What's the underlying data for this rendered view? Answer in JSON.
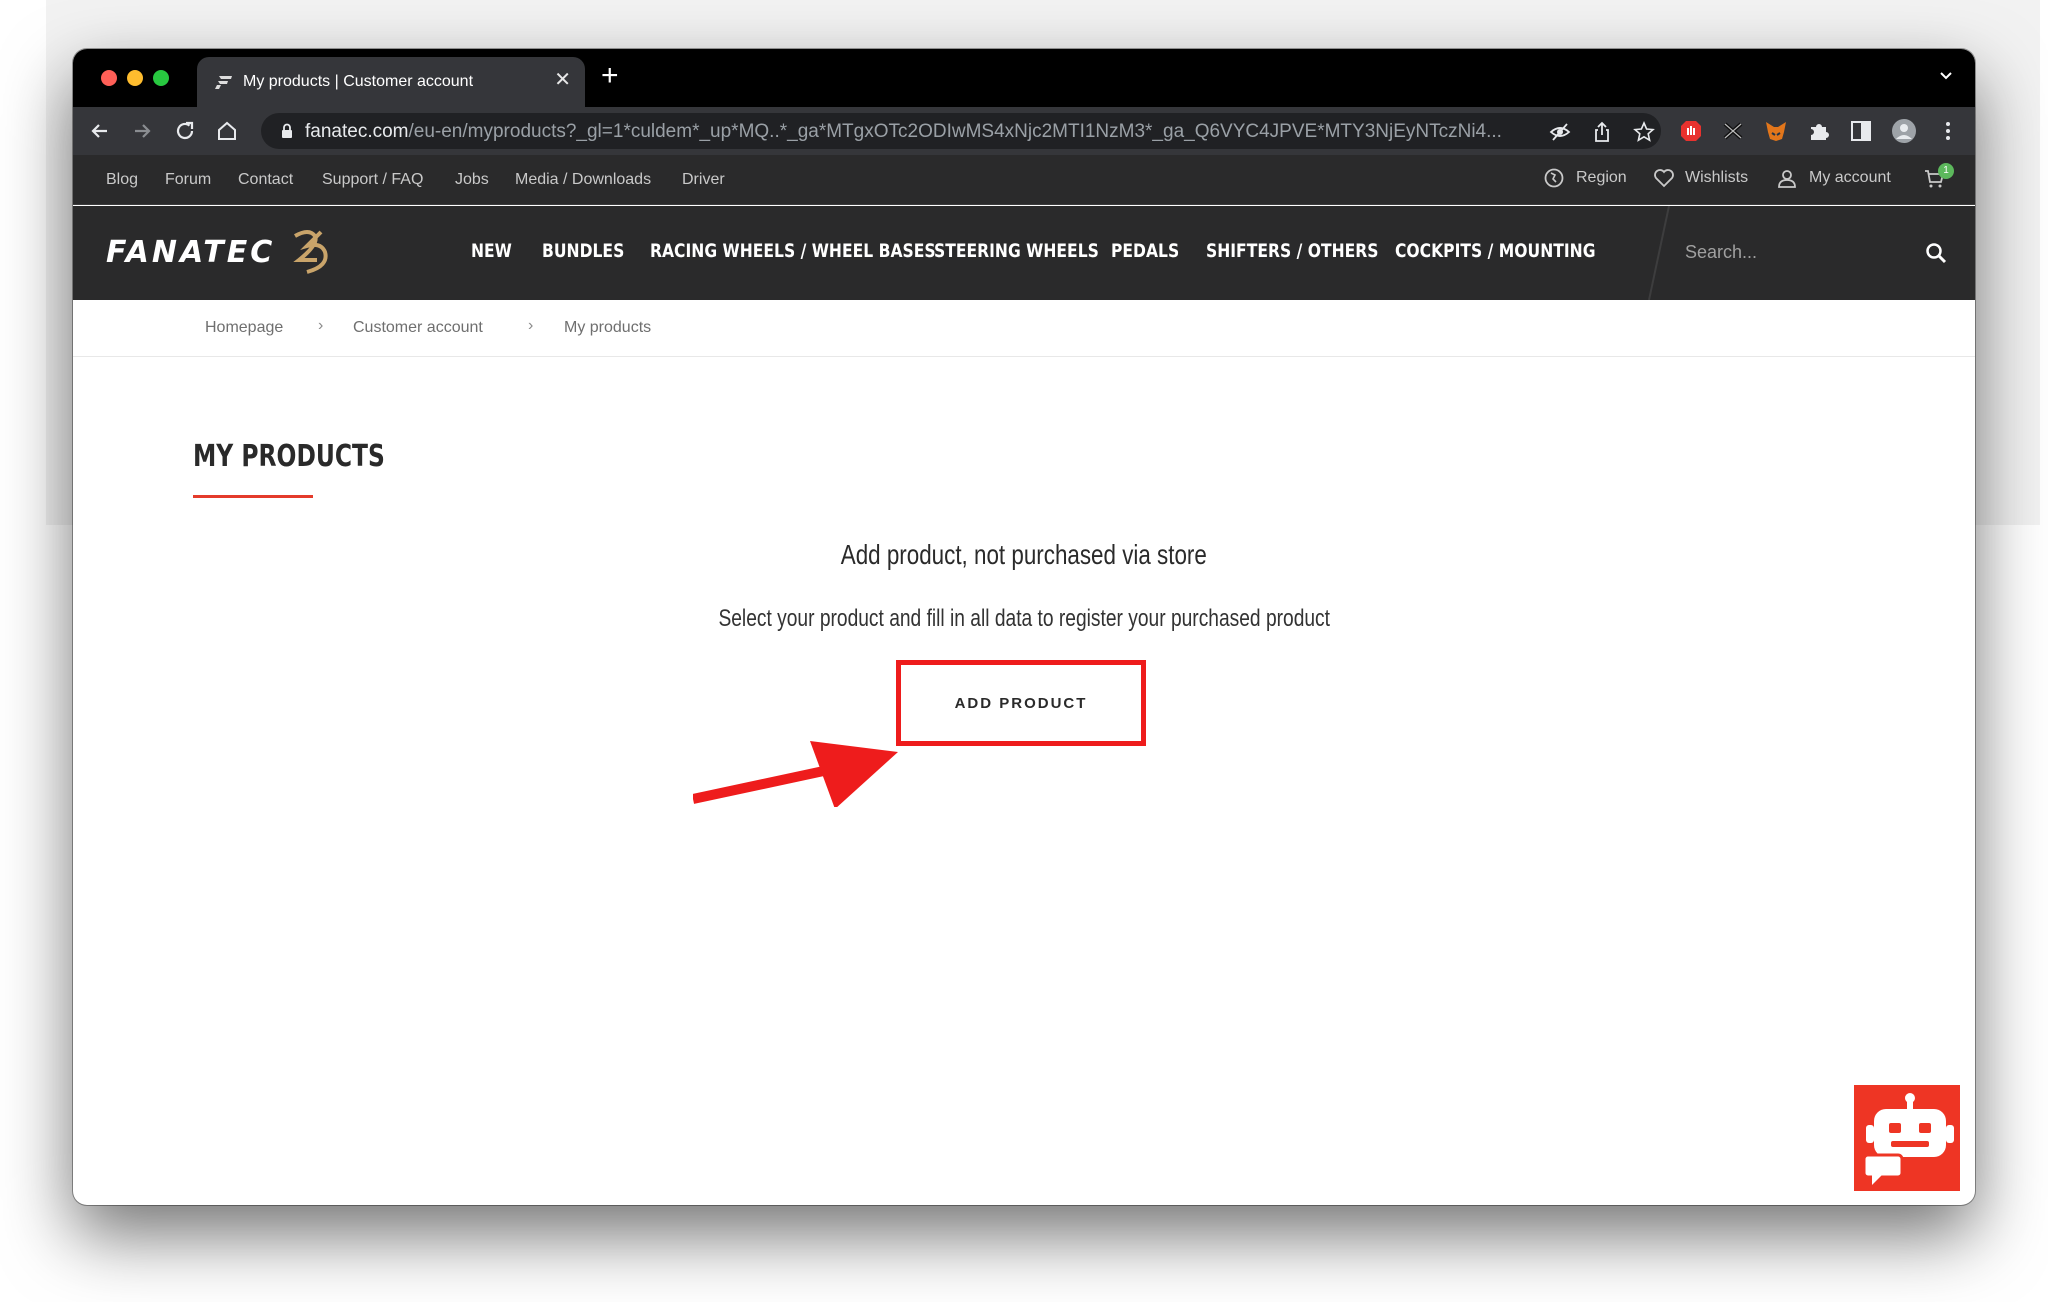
{
  "browser": {
    "tab_title": "My products | Customer account",
    "tab_close": "✕",
    "new_tab": "+",
    "url_host": "fanatec.com",
    "url_path": "/eu-en/myproducts?_gl=1*culdem*_up*MQ..*_ga*MTgxOTc2ODIwMS4xNjc2MTI1NzM3*_ga_Q6VYC4JPVE*MTY3NjEyNTczNi4..."
  },
  "utility_nav": {
    "links": [
      "Blog",
      "Forum",
      "Contact",
      "Support / FAQ",
      "Jobs",
      "Media / Downloads",
      "Driver"
    ],
    "region": "Region",
    "wishlists": "Wishlists",
    "account": "My account",
    "cart_count": "1"
  },
  "main_nav": {
    "logo": "FANATEC",
    "items": [
      "NEW",
      "BUNDLES",
      "RACING WHEELS / WHEEL BASES",
      "STEERING WHEELS",
      "PEDALS",
      "SHIFTERS / OTHERS",
      "COCKPITS / MOUNTING"
    ],
    "search_placeholder": "Search..."
  },
  "breadcrumb": {
    "items": [
      "Homepage",
      "Customer account",
      "My products"
    ],
    "separator": "›"
  },
  "content": {
    "title": "MY PRODUCTS",
    "heading": "Add product, not purchased via store",
    "text": "Select your product and fill in all data to register your purchased product",
    "button": "ADD PRODUCT"
  },
  "colors": {
    "accent": "#e43b2b",
    "annotation_red": "#ee1c1c",
    "nav_bg": "#2a2a2b",
    "chatbot_bg": "#ee3524"
  }
}
